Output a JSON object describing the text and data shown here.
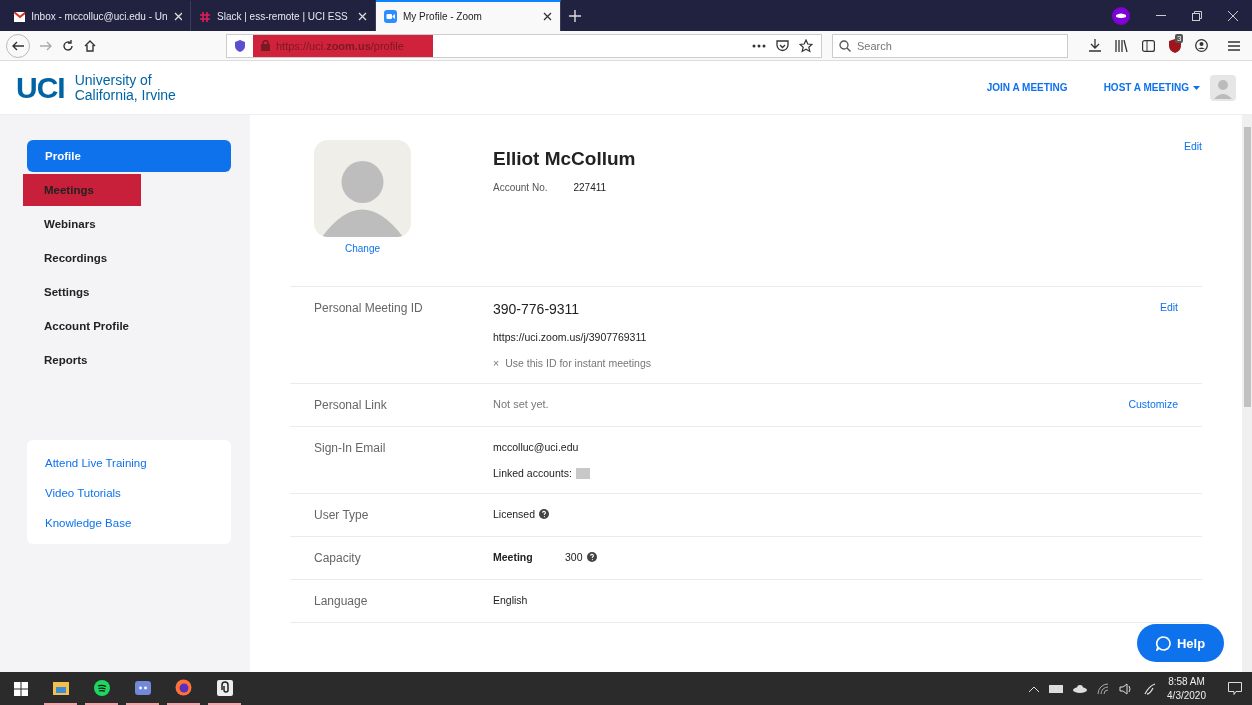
{
  "browser": {
    "tabs": [
      {
        "title": "Inbox - mccolluc@uci.edu - Un",
        "kind": "mail",
        "selected": false
      },
      {
        "title": "Slack | ess-remote | UCI ESS",
        "kind": "slack",
        "selected": false
      },
      {
        "title": "My Profile - Zoom",
        "kind": "zoom",
        "selected": true
      }
    ],
    "url": {
      "prefix": "https://uci.",
      "domain": "zoom.us",
      "path": "/profile",
      "highlighted": true
    },
    "search": {
      "placeholder": "Search"
    },
    "extension_badge": "3"
  },
  "header": {
    "logo_mark": "UCI",
    "logo_lines": [
      "University of",
      "California, Irvine"
    ],
    "nav": [
      {
        "label": "JOIN A MEETING",
        "dropdown": false
      },
      {
        "label": "HOST A MEETING",
        "dropdown": true
      }
    ]
  },
  "sidebar": {
    "items": [
      {
        "label": "Profile",
        "selected": true,
        "highlighted": false
      },
      {
        "label": "Meetings",
        "selected": false,
        "highlighted": true
      },
      {
        "label": "Webinars",
        "selected": false,
        "highlighted": false
      },
      {
        "label": "Recordings",
        "selected": false,
        "highlighted": false
      },
      {
        "label": "Settings",
        "selected": false,
        "highlighted": false
      },
      {
        "label": "Account Profile",
        "selected": false,
        "highlighted": false
      },
      {
        "label": "Reports",
        "selected": false,
        "highlighted": false
      }
    ],
    "links": [
      "Attend Live Training",
      "Video Tutorials",
      "Knowledge Base"
    ]
  },
  "profile": {
    "name": "Elliot McCollum",
    "account_label": "Account No.",
    "account_no": "227411",
    "change": "Change",
    "edit": "Edit"
  },
  "rows": [
    {
      "label": "Personal Meeting ID",
      "action": "Edit",
      "values": [
        {
          "kind": "large",
          "text": "390-776-9311"
        },
        {
          "kind": "plain",
          "text": "https://uci.zoom.us/j/3907769311"
        },
        {
          "kind": "option",
          "text": "Use this ID for instant meetings",
          "mark": "×"
        }
      ]
    },
    {
      "label": "Personal Link",
      "action": "Customize",
      "values": [
        {
          "kind": "muted",
          "text": "Not set yet."
        }
      ]
    },
    {
      "label": "Sign-In Email",
      "values": [
        {
          "kind": "plain",
          "text": "mccolluc@uci.edu"
        },
        {
          "kind": "linked",
          "text": "Linked accounts:"
        }
      ]
    },
    {
      "label": "User Type",
      "values": [
        {
          "kind": "help",
          "text": "Licensed"
        }
      ]
    },
    {
      "label": "Capacity",
      "values": [
        {
          "kind": "pair",
          "text": "Meeting",
          "value": "300"
        }
      ]
    },
    {
      "label": "Language",
      "values": [
        {
          "kind": "plain",
          "text": "English"
        }
      ]
    }
  ],
  "help_button": "Help",
  "taskbar": {
    "time": "8:58 AM",
    "date": "4/3/2020",
    "apps": [
      {
        "kind": "explorer",
        "running": true
      },
      {
        "kind": "spotify",
        "running": true
      },
      {
        "kind": "discord",
        "running": true
      },
      {
        "kind": "firefox",
        "running": true
      },
      {
        "kind": "clip",
        "running": true
      }
    ]
  }
}
